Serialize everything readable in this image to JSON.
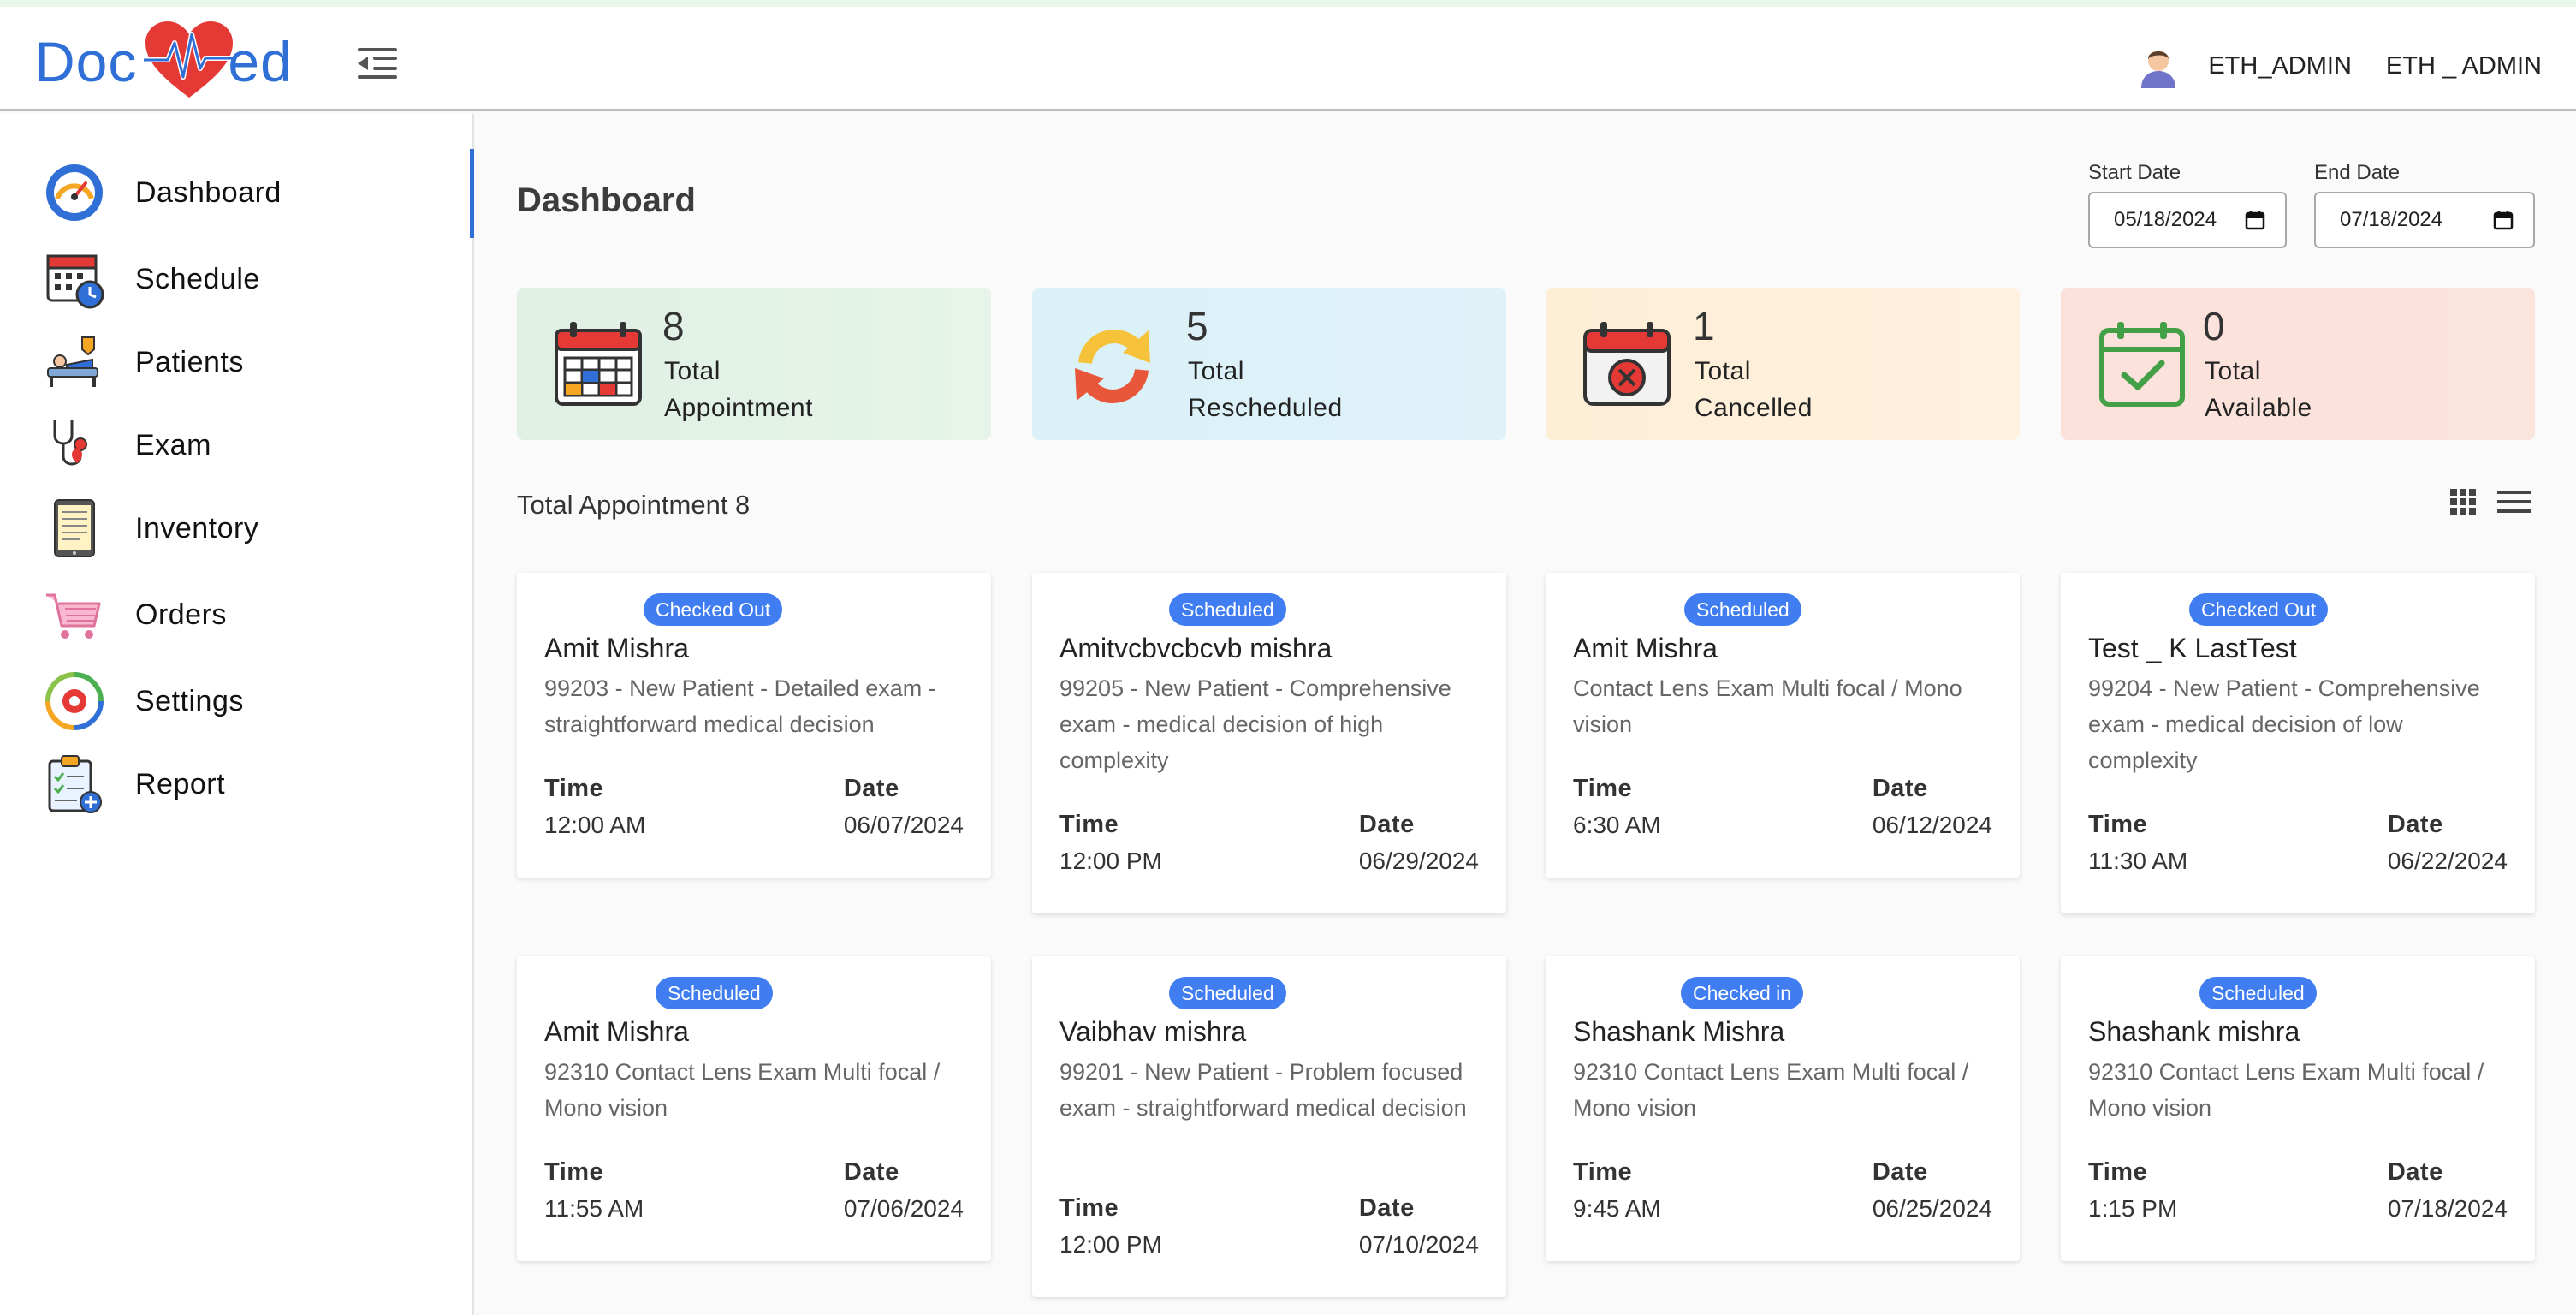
{
  "header": {
    "logo_left": "Doc",
    "logo_right": "ed",
    "user_name": "ETH_ADMIN",
    "user_name_secondary": "ETH _ ADMIN"
  },
  "sidebar": {
    "items": [
      {
        "label": "Dashboard",
        "icon": "dashboard-gauge-icon",
        "active": true
      },
      {
        "label": "Schedule",
        "icon": "calendar-clock-icon"
      },
      {
        "label": "Patients",
        "icon": "patient-bed-icon"
      },
      {
        "label": "Exam",
        "icon": "stethoscope-icon"
      },
      {
        "label": "Inventory",
        "icon": "tablet-list-icon"
      },
      {
        "label": "Orders",
        "icon": "shopping-cart-icon"
      },
      {
        "label": "Settings",
        "icon": "gear-cycle-icon"
      },
      {
        "label": "Report",
        "icon": "clipboard-report-icon"
      }
    ]
  },
  "main": {
    "title": "Dashboard",
    "start_date": {
      "label": "Start Date",
      "value": "05/18/2024"
    },
    "end_date": {
      "label": "End Date",
      "value": "07/18/2024"
    },
    "stats": [
      {
        "value": "8",
        "line1": "Total",
        "line2": "Appointment",
        "icon": "calendar-icon",
        "color": "#e3f3e6"
      },
      {
        "value": "5",
        "line1": "Total",
        "line2": "Rescheduled",
        "icon": "refresh-arrows-icon",
        "color": "#dcf1f6"
      },
      {
        "value": "1",
        "line1": "Total",
        "line2": "Cancelled",
        "icon": "calendar-cancel-icon",
        "color": "#fdf0d9"
      },
      {
        "value": "0",
        "line1": "Total",
        "line2": "Available",
        "icon": "calendar-check-icon",
        "color": "#fbe2da"
      }
    ],
    "section_title": "Total Appointment 8",
    "appointments": [
      {
        "status": "Checked Out",
        "name": "Amit Mishra",
        "description": "99203 - New Patient - Detailed exam - straightforward medical decision",
        "time_label": "Time",
        "time": "12:00 AM",
        "date_label": "Date",
        "date": "06/07/2024"
      },
      {
        "status": "Scheduled",
        "name": "Amitvcbvcbcvb mishra",
        "description": "99205 - New Patient - Comprehensive exam - medical decision of high complexity",
        "time_label": "Time",
        "time": "12:00 PM",
        "date_label": "Date",
        "date": "06/29/2024"
      },
      {
        "status": "Scheduled",
        "name": "Amit Mishra",
        "description": "Contact Lens Exam Multi focal / Mono vision",
        "time_label": "Time",
        "time": "6:30 AM",
        "date_label": "Date",
        "date": "06/12/2024"
      },
      {
        "status": "Checked Out",
        "name": "Test _ K LastTest",
        "description": "99204 - New Patient - Comprehensive exam - medical decision of low complexity",
        "time_label": "Time",
        "time": "11:30 AM",
        "date_label": "Date",
        "date": "06/22/2024"
      },
      {
        "status": "Scheduled",
        "name": "Amit Mishra",
        "description": "92310 Contact Lens Exam Multi focal / Mono vision",
        "time_label": "Time",
        "time": "11:55 AM",
        "date_label": "Date",
        "date": "07/06/2024"
      },
      {
        "status": "Scheduled",
        "name": "Vaibhav mishra",
        "description": "99201 - New Patient - Problem focused exam - straightforward medical decision",
        "time_label": "Time",
        "time": "12:00 PM",
        "date_label": "Date",
        "date": "07/10/2024"
      },
      {
        "status": "Checked in",
        "name": "Shashank Mishra",
        "description": "92310 Contact Lens Exam Multi focal / Mono vision",
        "time_label": "Time",
        "time": "9:45 AM",
        "date_label": "Date",
        "date": "06/25/2024"
      },
      {
        "status": "Scheduled",
        "name": "Shashank mishra",
        "description": "92310 Contact Lens Exam Multi focal / Mono vision",
        "time_label": "Time",
        "time": "1:15 PM",
        "date_label": "Date",
        "date": "07/18/2024"
      }
    ]
  },
  "colors": {
    "brand": "#2f6fd6",
    "heart": "#e53935",
    "badge": "#3f7df0"
  }
}
